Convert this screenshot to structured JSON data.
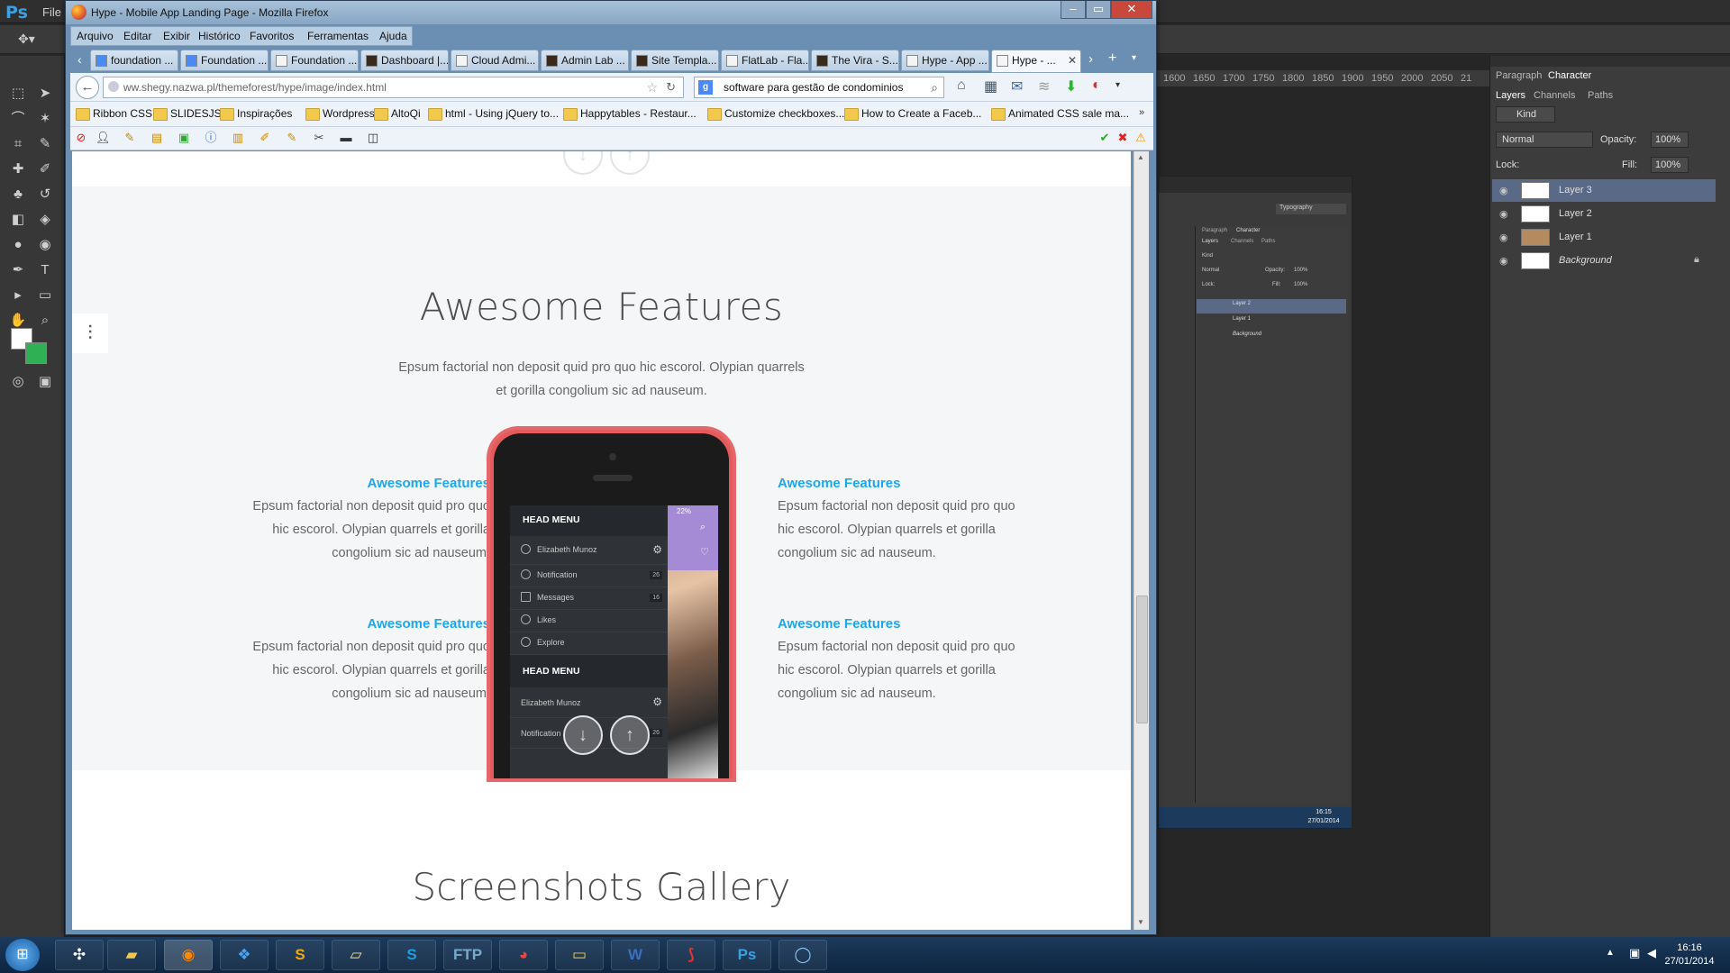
{
  "photoshop": {
    "file_menu": "File",
    "workspace": "Typography",
    "panel_tabs": [
      "Paragraph",
      "Character"
    ],
    "layer_tabs": [
      "Layers",
      "Channels",
      "Paths"
    ],
    "kind_label": "Kind",
    "blend_mode": "Normal",
    "opacity_label": "Opacity:",
    "opacity_value": "100%",
    "lock_label": "Lock:",
    "fill_label": "Fill:",
    "fill_value": "100%",
    "layers": [
      "Layer 3",
      "Layer 2",
      "Layer 1",
      "Background"
    ],
    "ruler_ticks": [
      "1600",
      "1650",
      "1700",
      "1750",
      "1800",
      "1850",
      "1900",
      "1950",
      "2000",
      "2050",
      "21"
    ],
    "inner_time": "16:15",
    "inner_date": "27/01/2014"
  },
  "firefox": {
    "window_title": "Hype - Mobile App Landing Page - Mozilla Firefox",
    "menu": [
      "Arquivo",
      "Editar",
      "Exibir",
      "Histórico",
      "Favoritos",
      "Ferramentas",
      "Ajuda"
    ],
    "tabs": [
      "foundation ...",
      "Foundation ...",
      "Foundation ...",
      "Dashboard |...",
      "Cloud Admi...",
      "Admin Lab ...",
      "Site Templa...",
      "FlatLab - Fla...",
      "The Vira - S...",
      "Hype - App ...",
      "Hype - ..."
    ],
    "url": "ww.shegy.nazwa.pl/themeforest/hype/image/index.html",
    "search_value": "software para gestão de condominios",
    "bookmarks": [
      "Ribbon CSS",
      "SLIDESJS",
      "Inspirações",
      "Wordpress",
      "AltoQi",
      "html - Using jQuery to...",
      "Happytables - Restaur...",
      "Customize checkboxes...",
      "How to Create a Faceb...",
      "Animated CSS sale ma..."
    ]
  },
  "page": {
    "features_title": "Awesome Features",
    "features_subtitle": "Epsum factorial non deposit quid pro quo hic escorol. Olypian quarrels et gorilla congolium sic ad nauseum.",
    "features": [
      {
        "title": "Awesome Features",
        "text": "Epsum factorial non deposit quid pro quo hic escorol. Olypian quarrels et gorilla congolium sic ad nauseum."
      },
      {
        "title": "Awesome Features",
        "text": "Epsum factorial non deposit quid pro quo hic escorol. Olypian quarrels et gorilla congolium sic ad nauseum."
      },
      {
        "title": "Awesome Features",
        "text": "Epsum factorial non deposit quid pro quo hic escorol. Olypian quarrels et gorilla congolium sic ad nauseum."
      },
      {
        "title": "Awesome Features",
        "text": "Epsum factorial non deposit quid pro quo hic escorol. Olypian quarrels et gorilla congolium sic ad nauseum."
      }
    ],
    "gallery_title": "Screenshots Gallery",
    "phone": {
      "status": "22%",
      "head_menu": "HEAD MENU",
      "user": "Elizabeth Munoz",
      "items": [
        "Notification",
        "Messages",
        "Likes",
        "Explore"
      ],
      "counts": [
        "26",
        "16"
      ],
      "head_menu_2": "HEAD MENU",
      "user_2": "Elizabeth Munoz",
      "item_2": "Notification",
      "count_2": "26"
    }
  },
  "taskbar": {
    "time": "16:16",
    "date": "27/01/2014"
  },
  "colors": {
    "accent": "#1ca7ec",
    "phone": "#e55a5a"
  }
}
